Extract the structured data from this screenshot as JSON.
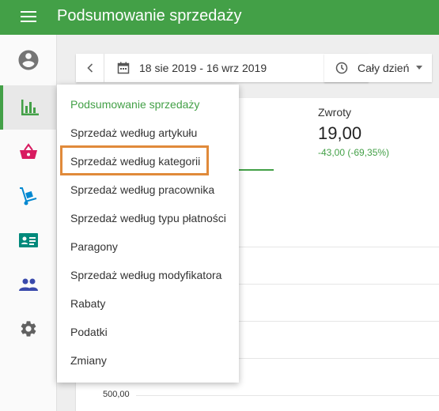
{
  "header": {
    "title": "Podsumowanie sprzedaży"
  },
  "sidebar": {
    "items": [
      {
        "name": "account",
        "icon": "account-circle-icon",
        "active": false
      },
      {
        "name": "reports",
        "icon": "bar-chart-icon",
        "active": true
      },
      {
        "name": "items",
        "icon": "basket-icon",
        "active": false
      },
      {
        "name": "inventory",
        "icon": "hand-truck-icon",
        "active": false
      },
      {
        "name": "employees",
        "icon": "id-card-icon",
        "active": false
      },
      {
        "name": "customers",
        "icon": "people-icon",
        "active": false
      },
      {
        "name": "settings",
        "icon": "gear-icon",
        "active": false
      }
    ]
  },
  "filters": {
    "date_range": "18 sie 2019 - 16 wrz 2019",
    "prev_icon": "chevron-left-icon",
    "next_icon": "chevron-right-icon",
    "time_filter": "Cały dzień"
  },
  "summary": {
    "refunds_label": "Zwroty",
    "refunds_value": "19,00",
    "refunds_change": "-43,00 (-69,35%)"
  },
  "chart": {
    "y_tick": "500,00"
  },
  "report_menu": {
    "items": [
      "Podsumowanie sprzedaży",
      "Sprzedaż według artykułu",
      "Sprzedaż według kategorii",
      "Sprzedaż według pracownika",
      "Sprzedaż według typu płatności",
      "Paragony",
      "Sprzedaż według modyfikatora",
      "Rabaty",
      "Podatki",
      "Zmiany"
    ],
    "current_index": 0,
    "highlighted_index": 2
  },
  "colors": {
    "primary": "#43a047",
    "basket": "#d81b60",
    "inventory": "#0288d1",
    "employee_card": "#00897b",
    "people": "#3949ab",
    "settings": "#616161",
    "highlight_border": "#e08a3a"
  }
}
